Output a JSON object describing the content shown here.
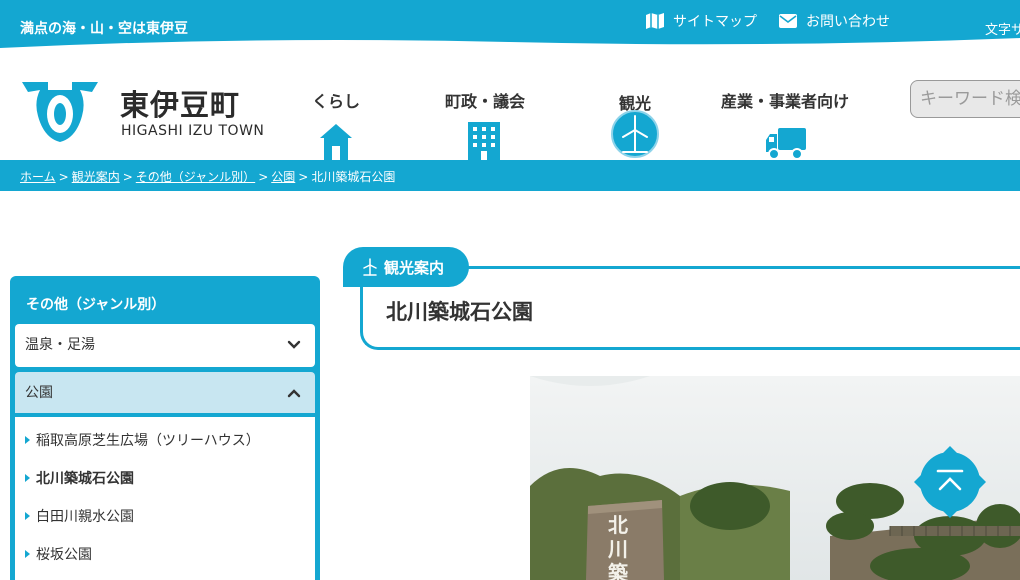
{
  "topbar": {
    "tagline": "満点の海・山・空は東伊豆",
    "sitemap_label": "サイトマップ",
    "contact_label": "お問い合わせ",
    "fontsize_label": "文字サ"
  },
  "logo": {
    "name_ja": "東伊豆町",
    "name_en": "HIGASHI IZU TOWN"
  },
  "gnav": [
    {
      "label": "くらし",
      "icon": "house-icon"
    },
    {
      "label": "町政・議会",
      "icon": "building-icon"
    },
    {
      "label": "観光",
      "icon": "windmill-icon"
    },
    {
      "label": "産業・事業者向け",
      "icon": "truck-icon"
    }
  ],
  "search": {
    "placeholder": "キーワード検"
  },
  "breadcrumb": {
    "items": [
      "ホーム",
      "観光案内",
      "その他（ジャンル別）",
      "公園"
    ],
    "current": "北川築城石公園",
    "separator": ">"
  },
  "side": {
    "title": "その他（ジャンル別）",
    "categories": [
      {
        "label": "温泉・足湯",
        "state": "collapsed"
      },
      {
        "label": "公園",
        "state": "expanded"
      }
    ],
    "subitems": [
      "稲取高原芝生広場（ツリーハウス）",
      "北川築城石公園",
      "白田川親水公園",
      "桜坂公園"
    ],
    "active_subitem": "北川築城石公園"
  },
  "main": {
    "section_label": "観光案内",
    "page_title": "北川築城石公園",
    "photo_sign_text": "北川築城"
  },
  "colors": {
    "accent": "#14a7d1",
    "accent_light": "#c8e6f1"
  }
}
